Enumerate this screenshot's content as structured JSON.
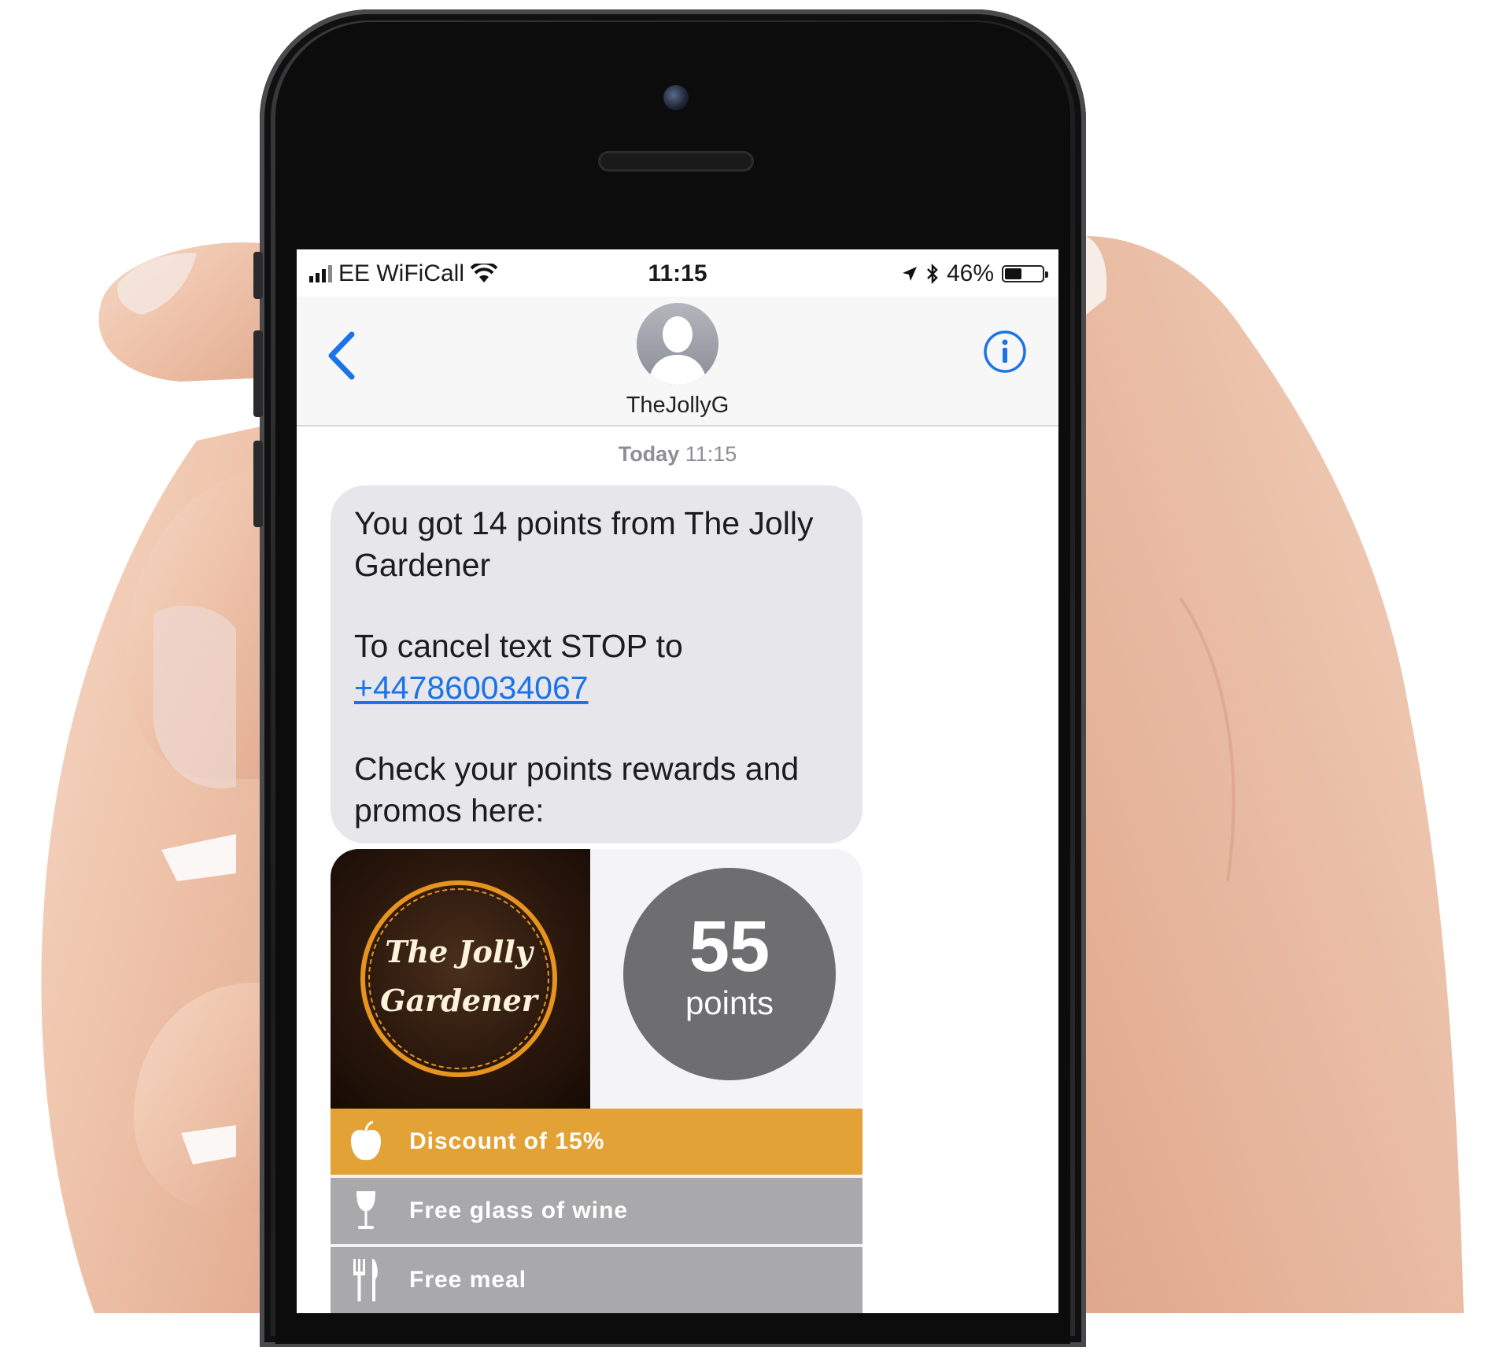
{
  "status_bar": {
    "carrier": "EE WiFiCall",
    "time": "11:15",
    "battery": "46%",
    "battery_level": 0.46
  },
  "nav": {
    "contact_name": "TheJollyG"
  },
  "thread": {
    "timestamp_day": "Today",
    "timestamp_time": "11:15"
  },
  "message": {
    "line1": "You got 14 points from The Jolly Gardener",
    "line2": "To cancel text STOP to",
    "phone_link": "+447860034067",
    "line3": "Check your points rewards and promos here:"
  },
  "card": {
    "logo_line1": "The Jolly",
    "logo_line2": "Gardener",
    "points_value": "55",
    "points_label": "points",
    "rewards": [
      {
        "label": "Discount of 15%",
        "icon": "apple-icon",
        "color": "#e2a235"
      },
      {
        "label": "Free glass of wine",
        "icon": "wine-glass-icon",
        "color": "#a9a9ab"
      },
      {
        "label": "Free meal",
        "icon": "fork-knife-icon",
        "color": "#a9a9ab"
      }
    ]
  },
  "colors": {
    "ios_blue": "#1a73e8",
    "bubble_gray": "#e6e6eb",
    "accent_gold": "#e2a235"
  }
}
